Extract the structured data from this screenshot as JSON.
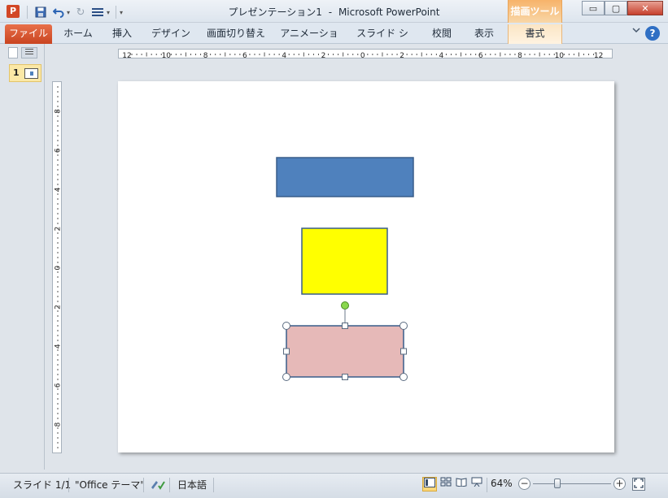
{
  "window": {
    "title_doc": "プレゼンテーション1",
    "title_sep": "-",
    "title_app": "Microsoft PowerPoint",
    "context_tab_group": "描画ツール",
    "app_icon_letter": "P",
    "buttons": {
      "minimize": "▭",
      "maximize": "▢",
      "close": "✕"
    }
  },
  "qat": {
    "save_icon": "💾",
    "undo_icon": "↶",
    "redo_icon": "↻",
    "custom_icon": "☰",
    "dropdown_glyph": "▾"
  },
  "ribbon_tabs": [
    {
      "label": "ファイル",
      "type": "file"
    },
    {
      "label": "ホーム"
    },
    {
      "label": "挿入"
    },
    {
      "label": "デザイン"
    },
    {
      "label": "画面切り替え"
    },
    {
      "label": "アニメーション"
    },
    {
      "label": "スライド ショー"
    },
    {
      "label": "校閲"
    },
    {
      "label": "表示"
    },
    {
      "label": "書式",
      "type": "context"
    }
  ],
  "ribbon": {
    "help": "?",
    "minimize_glyph": "♡"
  },
  "thumbnails": {
    "slide_number": "1"
  },
  "rulers": {
    "horizontal_labels": [
      "12",
      "10",
      "8",
      "6",
      "4",
      "2",
      "0",
      "2",
      "4",
      "6",
      "8",
      "10",
      "12"
    ],
    "vertical_labels": [
      "8",
      "6",
      "4",
      "2",
      "0",
      "2",
      "4",
      "6",
      "8"
    ]
  },
  "shapes": [
    {
      "name": "blue-rectangle",
      "fill": "#4f81bd",
      "stroke": "#385d8a"
    },
    {
      "name": "yellow-rectangle",
      "fill": "#ffff00",
      "stroke": "#385d8a"
    },
    {
      "name": "pink-rectangle",
      "fill": "#e6b9b8",
      "stroke": "#385d8a",
      "selected": true
    }
  ],
  "status": {
    "slide_info": "スライド 1/1",
    "theme": "\"Office テーマ\"",
    "language": "日本語",
    "zoom": "64%",
    "zoom_minus": "−",
    "zoom_plus": "+"
  },
  "colors": {
    "accent_file_tab": "#d24726",
    "context_tab": "#f7b36a",
    "selection_handle": "#ffffff",
    "rotate_handle": "#8ad84e"
  }
}
